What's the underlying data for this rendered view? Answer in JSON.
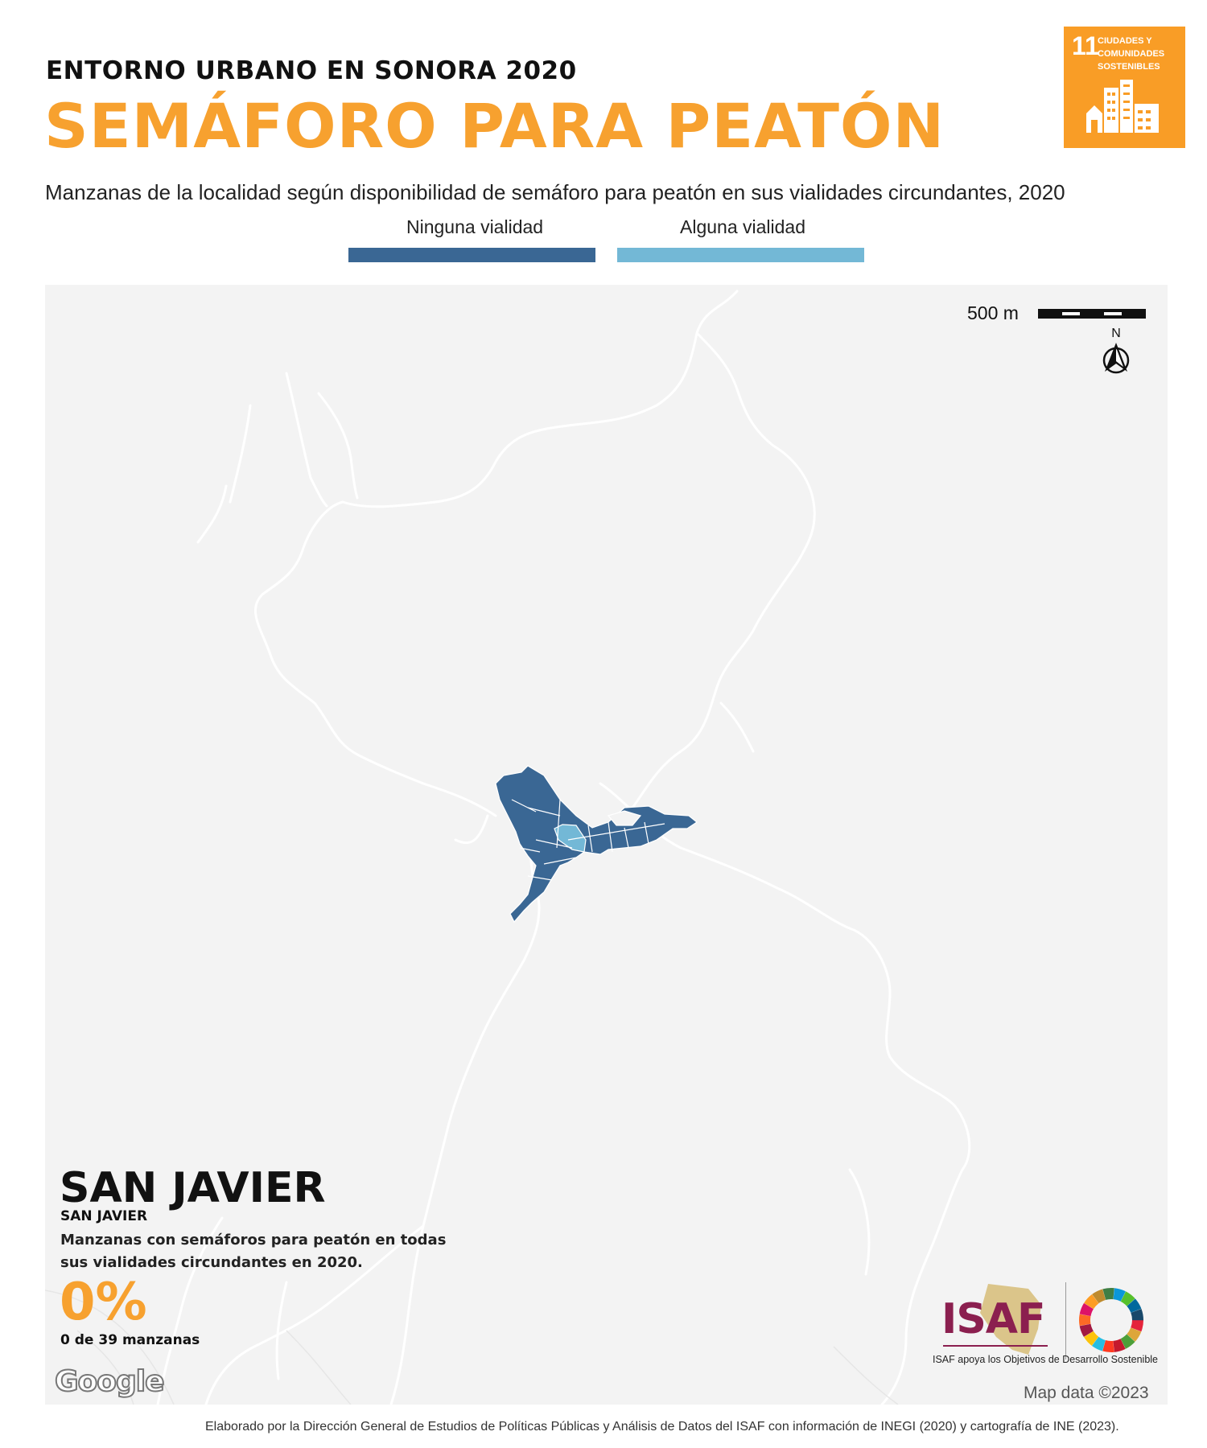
{
  "header": {
    "kicker": "ENTORNO URBANO EN SONORA 2020",
    "title": "SEMÁFORO PARA PEATÓN",
    "subtitle": "Manzanas de la localidad según disponibilidad de semáforo para peatón en sus vialidades circundantes, 2020"
  },
  "sdg_badge": {
    "number": "11",
    "line1": "CIUDADES Y",
    "line2": "COMUNIDADES",
    "line3": "SOSTENIBLES",
    "color": "#f99d26"
  },
  "legend": {
    "items": [
      {
        "label": "Ninguna vialidad",
        "color": "#3a6794"
      },
      {
        "label": "Alguna vialidad",
        "color": "#73b8d6"
      }
    ]
  },
  "map": {
    "background": "#f3f3f3",
    "road_color": "#ffffff",
    "scale_label": "500 m",
    "north_label": "N",
    "attribution": "Map data ©2023",
    "provider": "Google"
  },
  "locality": {
    "name": "SAN JAVIER",
    "municipality": "SAN JAVIER",
    "stat_description": "Manzanas con semáforos para peatón en todas sus vialidades circundantes en 2020.",
    "stat_value": "0%",
    "stat_count": "0 de 39 manzanas"
  },
  "branding": {
    "isaf": "ISAF",
    "tagline": "ISAF apoya los Objetivos de Desarrollo Sostenible"
  },
  "footer": "Elaborado por la Dirección General de Estudios de Políticas Públicas y Análisis de Datos del ISAF con información de INEGI (2020) y cartografía de INE (2023)."
}
